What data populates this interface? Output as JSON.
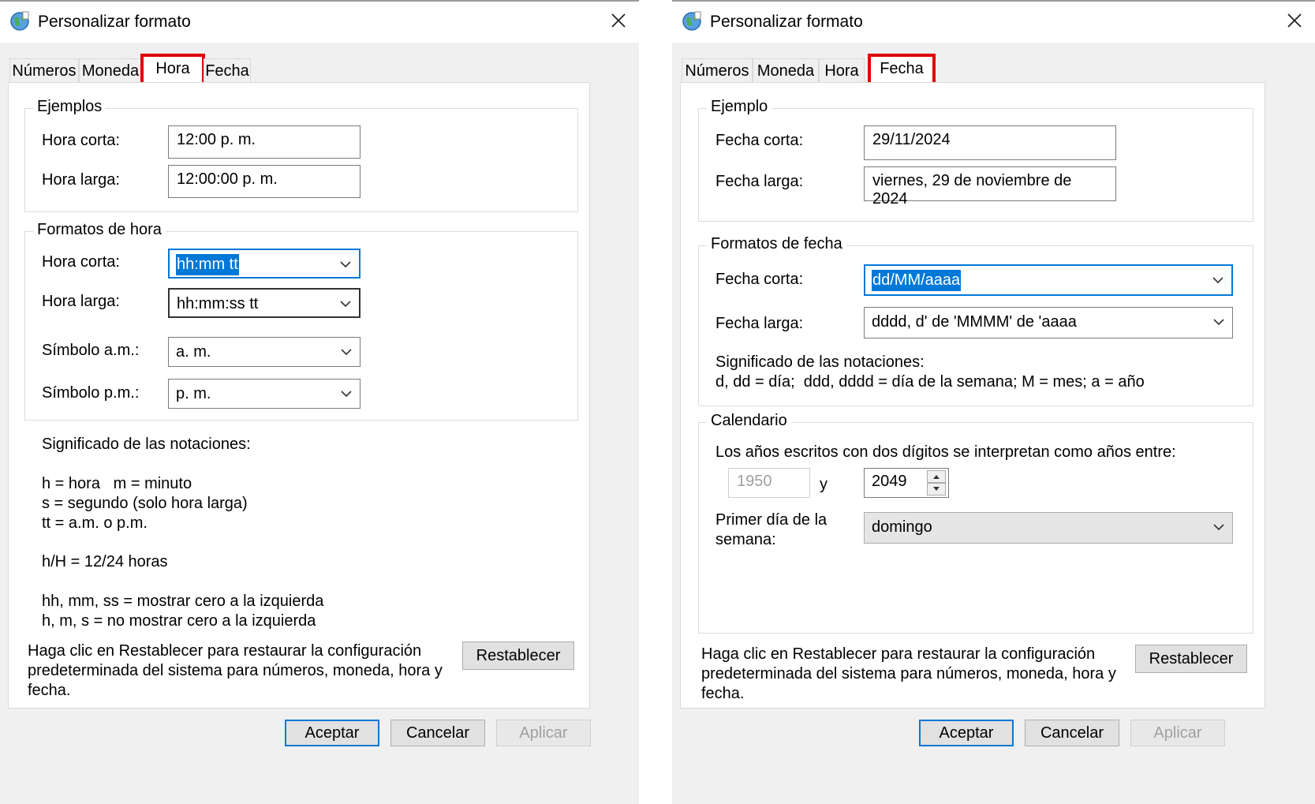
{
  "dialog_hora": {
    "title": "Personalizar formato",
    "tabs": [
      "Números",
      "Moneda",
      "Hora",
      "Fecha"
    ],
    "active_tab": "Hora",
    "examples": {
      "group_title": "Ejemplos",
      "short_label": "Hora corta:",
      "short_value": "12:00 p. m.",
      "long_label": "Hora larga:",
      "long_value": "12:00:00 p. m."
    },
    "formats": {
      "group_title": "Formatos de hora",
      "short_label": "Hora corta:",
      "short_value": "hh:mm tt",
      "long_label": "Hora larga:",
      "long_value": "hh:mm:ss tt",
      "am_label": "Símbolo a.m.:",
      "am_value": "a. m.",
      "pm_label": "Símbolo p.m.:",
      "pm_value": "p. m."
    },
    "notation": {
      "title": "Significado de las notaciones:",
      "line1": "h = hora   m = minuto",
      "line2": "s = segundo (solo hora larga)",
      "line3": "tt = a.m. o p.m.",
      "line4": "h/H = 12/24 horas",
      "line5": "hh, mm, ss = mostrar cero a la izquierda",
      "line6": "h, m, s = no mostrar cero a la izquierda"
    },
    "reset_text_1": "Haga clic en Restablecer para restaurar la configuración",
    "reset_text_2": "predeterminada del sistema para números, moneda, hora y",
    "reset_text_3": "fecha.",
    "reset_button": "Restablecer",
    "ok_button": "Aceptar",
    "cancel_button": "Cancelar",
    "apply_button": "Aplicar"
  },
  "dialog_fecha": {
    "title": "Personalizar formato",
    "tabs": [
      "Números",
      "Moneda",
      "Hora",
      "Fecha"
    ],
    "active_tab": "Fecha",
    "example": {
      "group_title": "Ejemplo",
      "short_label": "Fecha corta:",
      "short_value": "29/11/2024",
      "long_label": "Fecha larga:",
      "long_value": "viernes, 29 de noviembre de 2024"
    },
    "formats": {
      "group_title": "Formatos de fecha",
      "short_label": "Fecha corta:",
      "short_value": "dd/MM/aaaa",
      "long_label": "Fecha larga:",
      "long_value": "dddd, d' de 'MMMM' de 'aaaa",
      "notation_title": "Significado de las notaciones:",
      "notation_line": "d, dd = día;  ddd, dddd = día de la semana; M = mes; a = año"
    },
    "calendar": {
      "group_title": "Calendario",
      "two_digit_text": "Los años escritos con dos dígitos se interpretan como años entre:",
      "year_from": "1950",
      "and_label": "y",
      "year_to": "2049",
      "first_day_label_1": "Primer día de la",
      "first_day_label_2": "semana:",
      "first_day_value": "domingo"
    },
    "reset_text_1": "Haga clic en Restablecer para restaurar la configuración",
    "reset_text_2": "predeterminada del sistema para números, moneda, hora y",
    "reset_text_3": "fecha.",
    "reset_button": "Restablecer",
    "ok_button": "Aceptar",
    "cancel_button": "Cancelar",
    "apply_button": "Aplicar"
  },
  "colors": {
    "highlight": "#e00000",
    "selection": "#0078d7",
    "dialog_bg": "#f0f0f0"
  },
  "icons": {
    "title": "globe-icon",
    "close": "close-icon",
    "dropdown": "chevron-down-icon",
    "spin": "spin-arrows-icon"
  }
}
